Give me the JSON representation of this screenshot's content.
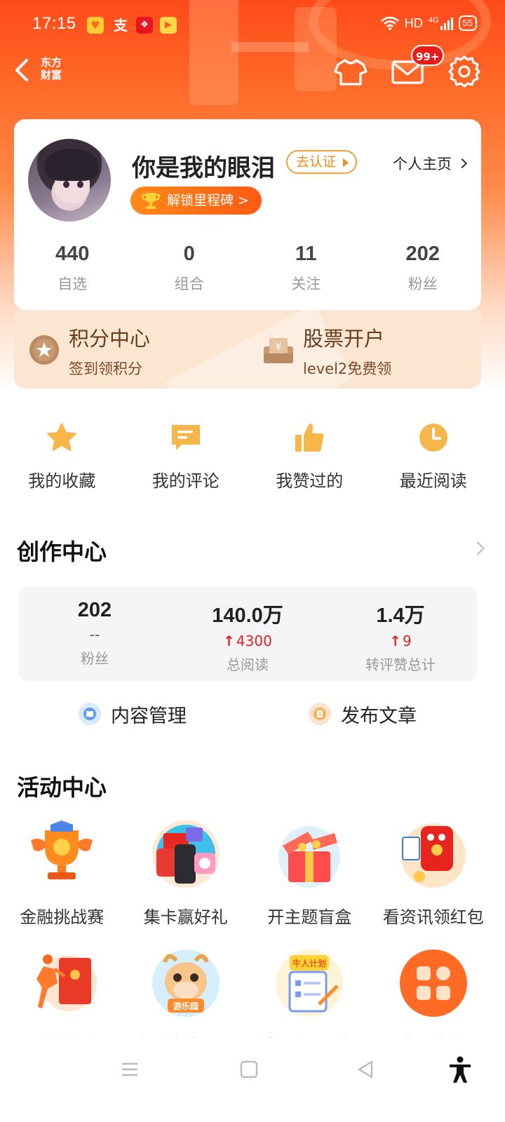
{
  "status_bar": {
    "time": "17:15",
    "app_icons": [
      "bell-app-icon",
      "alipay-icon",
      "shopping-app-icon",
      "video-app-icon"
    ],
    "network": "HD",
    "signal": "4G",
    "battery": "55"
  },
  "header": {
    "back_label": "东方财富",
    "brand_line1": "东方",
    "brand_line2": "财富",
    "mail_badge": "99+"
  },
  "profile": {
    "username": "你是我的眼泪",
    "verify_label": "去认证",
    "homepage_label": "个人主页",
    "milestone_label": "解锁里程碑 >",
    "stats": [
      {
        "value": "440",
        "label": "自选"
      },
      {
        "value": "0",
        "label": "组合"
      },
      {
        "value": "11",
        "label": "关注"
      },
      {
        "value": "202",
        "label": "粉丝"
      }
    ]
  },
  "points_bar": {
    "left_title": "积分中心",
    "left_sub": "签到领积分",
    "right_title": "股票开户",
    "right_sub": "level2免费领"
  },
  "quick_actions": [
    {
      "label": "我的收藏",
      "icon": "star-icon"
    },
    {
      "label": "我的评论",
      "icon": "comment-icon"
    },
    {
      "label": "我赞过的",
      "icon": "thumbs-up-icon"
    },
    {
      "label": "最近阅读",
      "icon": "clock-icon"
    }
  ],
  "creation_center": {
    "title": "创作中心",
    "stats": [
      {
        "value": "202",
        "delta": "--",
        "label": "粉丝"
      },
      {
        "value": "140.0万",
        "delta": "4300",
        "label": "总阅读"
      },
      {
        "value": "1.4万",
        "delta": "9",
        "label": "转评赞总计"
      }
    ],
    "manage_label": "内容管理",
    "publish_label": "发布文章"
  },
  "activity_center": {
    "title": "活动中心",
    "row1": [
      {
        "label": "金融挑战赛",
        "icon": "trophy-icon"
      },
      {
        "label": "集卡赢好礼",
        "icon": "gifts-phone-icon"
      },
      {
        "label": "开主题盲盒",
        "icon": "gift-box-icon"
      },
      {
        "label": "看资讯领红包",
        "icon": "red-envelope-icon"
      }
    ],
    "row2": [
      {
        "label": "开户享好礼",
        "icon": "runner-envelope-icon"
      },
      {
        "label": "东财宝宝乐园",
        "icon": "bull-mascot-icon",
        "badge": "游乐园"
      },
      {
        "label": "社区牛人计划",
        "icon": "plan-notebook-icon",
        "badge": "牛人计划"
      },
      {
        "label": "查看全部",
        "icon": "grid-icon"
      }
    ]
  },
  "colors": {
    "brand_orange": "#ff5a1a",
    "card_beige": "#fbe6d2",
    "up_red": "#e62020"
  }
}
